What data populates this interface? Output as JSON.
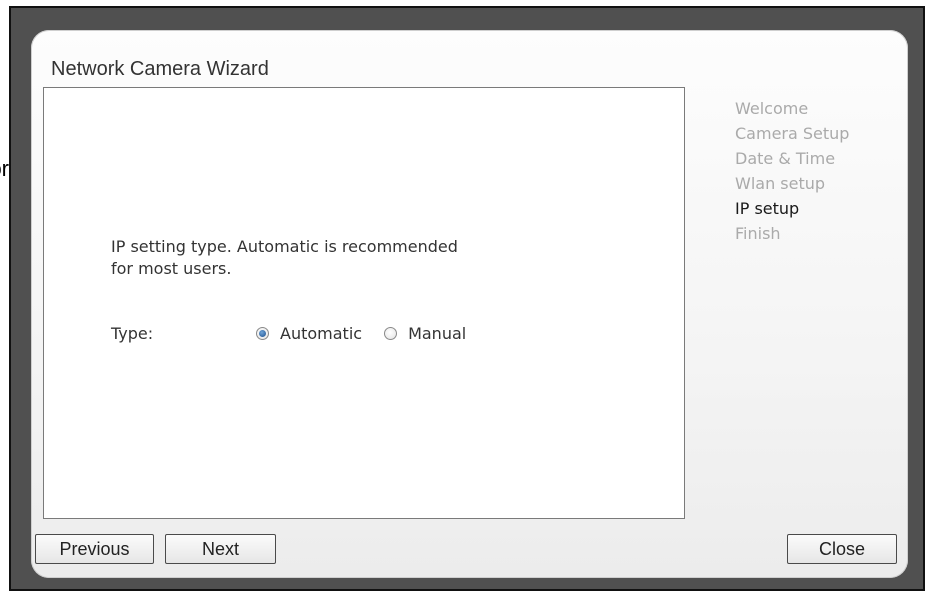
{
  "background": {
    "partial_text": "or"
  },
  "wizard": {
    "title": "Network Camera Wizard",
    "description_line1": "IP setting type. Automatic is recommended",
    "description_line2": "for most users.",
    "type_label": "Type:",
    "options": [
      {
        "label": "Automatic",
        "checked": true
      },
      {
        "label": "Manual",
        "checked": false
      }
    ],
    "steps": [
      {
        "label": "Welcome",
        "active": false
      },
      {
        "label": "Camera Setup",
        "active": false
      },
      {
        "label": "Date & Time",
        "active": false
      },
      {
        "label": "Wlan setup",
        "active": false
      },
      {
        "label": "IP setup",
        "active": true
      },
      {
        "label": "Finish",
        "active": false
      }
    ],
    "buttons": {
      "previous": "Previous",
      "next": "Next",
      "close": "Close"
    }
  },
  "colors": {
    "overlay": "#505050",
    "active_step": "#1a1a1a",
    "inactive_step": "#aaaaaa",
    "radio_selected": "#1c4f8e"
  }
}
